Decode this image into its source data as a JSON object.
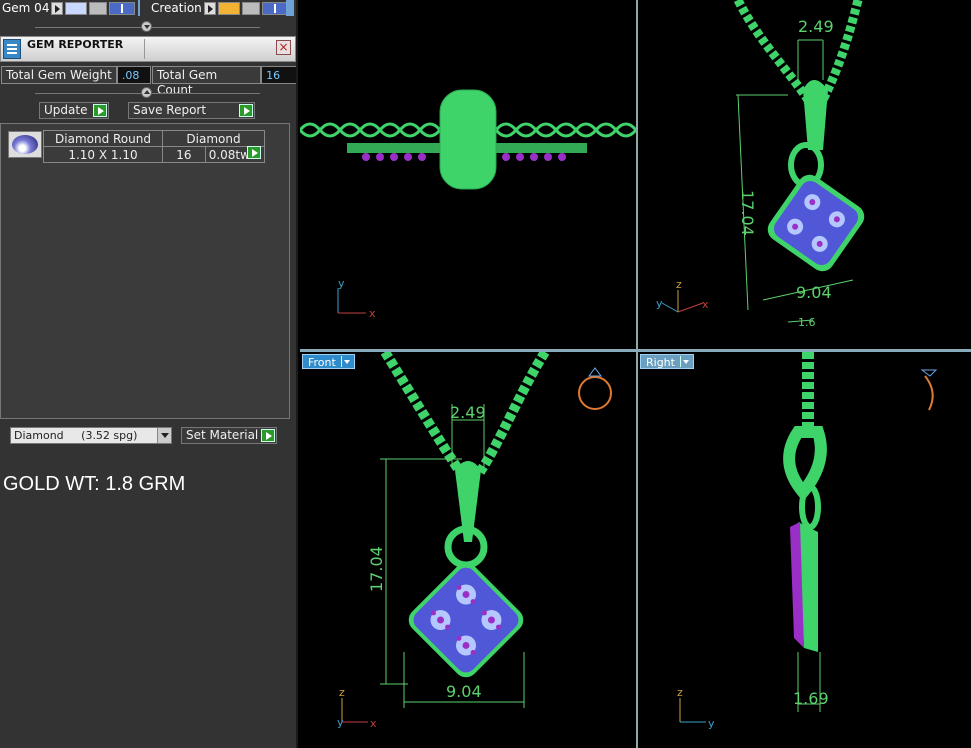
{
  "toolbar": {
    "gem_label": "Gem 04",
    "creation_label": "Creation"
  },
  "gem_reporter": {
    "title": "GEM REPORTER",
    "close_glyph": "×",
    "total_weight_label": "Total Gem Weight",
    "total_weight_value": ".08",
    "total_count_label": "Total Gem Count",
    "total_count_value": "16",
    "update_label": "Update",
    "save_report_label": "Save Report",
    "gems": [
      {
        "shape": "Diamond Round",
        "size": "1.10 X 1.10",
        "material": "Diamond",
        "count": "16",
        "weight": "0.08tw"
      }
    ],
    "material_select": "Diamond     (3.52 spg)",
    "set_material_label": "Set Material"
  },
  "gold_weight_text": "GOLD WT: 1.8 GRM",
  "viewports": {
    "front_label": "Front",
    "right_label": "Right",
    "axes": {
      "x": "x",
      "y": "y",
      "z": "z"
    },
    "dims": {
      "bail_width": "2.49",
      "height": "17.04",
      "width": "9.04",
      "depth_front": "1.69",
      "depth_persp": "1.6"
    }
  },
  "colors": {
    "metal": "#3fd46a",
    "gem_base": "#5058d8",
    "gem_highlight": "#b4c8ff",
    "prong_purple": "#9a2fc8",
    "dim_line": "#5cd16e",
    "panel_bg": "#333333",
    "viewport_label": "#2f8bc9"
  }
}
